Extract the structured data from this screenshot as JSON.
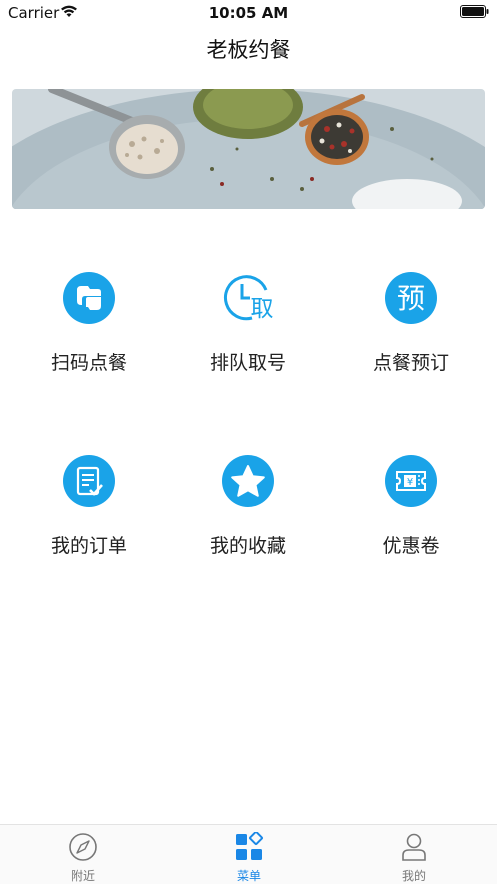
{
  "status_bar": {
    "carrier": "Carrier",
    "time": "10:05 AM"
  },
  "nav": {
    "title": "老板约餐"
  },
  "banner": {
    "description": "spices on plate image"
  },
  "grid": {
    "items": [
      {
        "label": "扫码点餐",
        "icon": "scan-icon"
      },
      {
        "label": "排队取号",
        "icon": "queue-clock-icon"
      },
      {
        "label": "点餐预订",
        "icon": "reserve-icon"
      },
      {
        "label": "我的订单",
        "icon": "order-list-icon"
      },
      {
        "label": "我的收藏",
        "icon": "star-icon"
      },
      {
        "label": "优惠卷",
        "icon": "coupon-icon"
      }
    ],
    "icon_glyphs": {
      "reserve": "预",
      "queue": "取"
    }
  },
  "tabbar": {
    "items": [
      {
        "label": "附近",
        "icon": "compass-icon",
        "active": false
      },
      {
        "label": "菜单",
        "icon": "menu-grid-icon",
        "active": true
      },
      {
        "label": "我的",
        "icon": "user-icon",
        "active": false
      }
    ]
  },
  "colors": {
    "accent": "#1aa3e8",
    "tab_active": "#1a87e6",
    "tab_inactive": "#777777"
  }
}
